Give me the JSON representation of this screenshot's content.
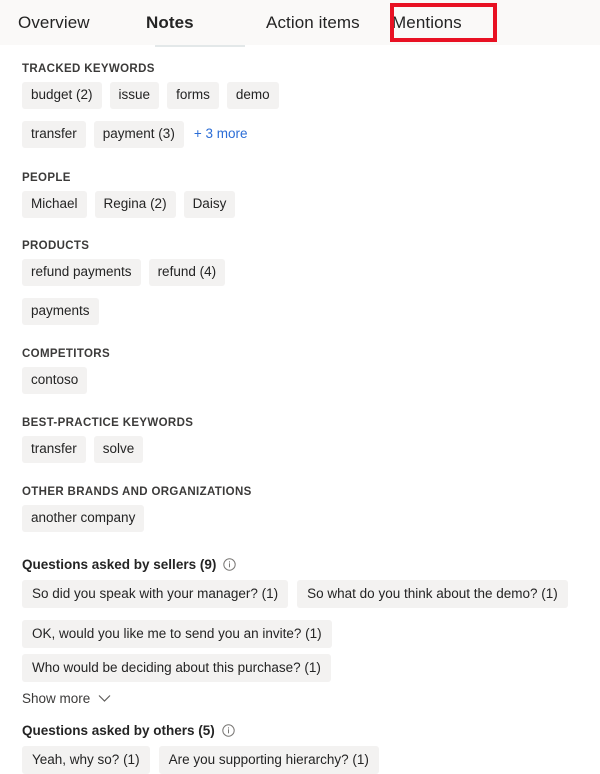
{
  "tabs": [
    {
      "label": "Overview",
      "selected": false
    },
    {
      "label": "Notes",
      "selected": true
    },
    {
      "label": "Action items",
      "selected": false
    },
    {
      "label": "Mentions",
      "selected": false,
      "highlighted": true
    }
  ],
  "sections": [
    {
      "title": "TRACKED KEYWORDS",
      "chips": [
        "budget (2)",
        "issue",
        "forms",
        "demo",
        "transfer",
        "payment (3)"
      ],
      "more_link": "+ 3 more"
    },
    {
      "title": "PEOPLE",
      "chips": [
        "Michael",
        "Regina (2)",
        "Daisy"
      ]
    },
    {
      "title": "PRODUCTS",
      "chips": [
        "refund payments",
        "refund (4)",
        "payments"
      ]
    },
    {
      "title": "COMPETITORS",
      "chips": [
        "contoso"
      ]
    },
    {
      "title": "BEST-PRACTICE KEYWORDS",
      "chips": [
        "transfer",
        "solve"
      ]
    },
    {
      "title": "OTHER BRANDS AND ORGANIZATIONS",
      "chips": [
        "another company"
      ]
    }
  ],
  "questions_sellers": {
    "title": "Questions asked by sellers (9)",
    "info_icon": "info-circle-icon",
    "chips": [
      "So did you speak with your manager? (1)",
      "So what do you think about the demo? (1)",
      "OK, would you like me to send you an invite? (1)",
      "Who would be deciding about this purchase? (1)"
    ],
    "show_more_label": "Show more",
    "show_more_icon": "chevron-down-icon"
  },
  "questions_others": {
    "title": "Questions asked by others (5)",
    "info_icon": "info-circle-icon",
    "chips": [
      "Yeah, why so? (1)",
      "Are you supporting hierarchy? (1)"
    ]
  },
  "colors": {
    "chip_bg": "#f3f2f1",
    "link": "#2b6dd6",
    "highlight_border": "#e81123",
    "tabbar_bg": "#faf9f8",
    "text": "#242424"
  }
}
